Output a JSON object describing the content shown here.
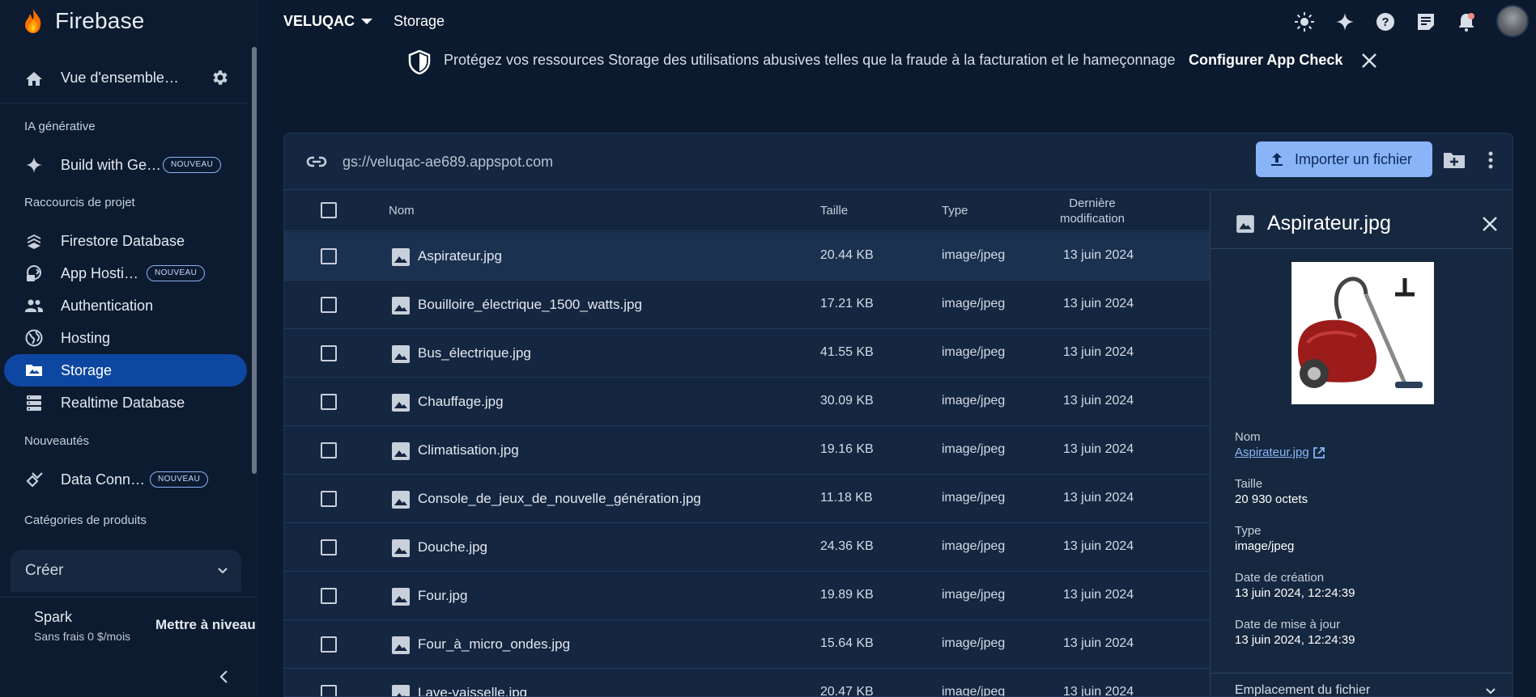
{
  "app": {
    "name": "Firebase"
  },
  "sidebar": {
    "overview_label": "Vue d'ensemble…",
    "sections": {
      "genai": "IA générative",
      "shortcuts": "Raccourcis de projet",
      "new": "Nouveautés",
      "categories": "Catégories de produits"
    },
    "items": [
      {
        "label": "Build with Ge…",
        "badge": "NOUVEAU",
        "icon": "sparkle-icon"
      },
      {
        "label": "Firestore Database",
        "icon": "firestore-icon"
      },
      {
        "label": "App Hosti…",
        "badge": "NOUVEAU",
        "icon": "app-hosting-icon"
      },
      {
        "label": "Authentication",
        "icon": "people-icon"
      },
      {
        "label": "Hosting",
        "icon": "globe-icon"
      },
      {
        "label": "Storage",
        "icon": "folder-image-icon",
        "active": true
      },
      {
        "label": "Realtime Database",
        "icon": "database-icon"
      },
      {
        "label": "Data Conn…",
        "badge": "NOUVEAU",
        "icon": "data-connect-icon"
      }
    ],
    "create_label": "Créer",
    "plan": {
      "name": "Spark",
      "desc": "Sans frais 0 $/mois",
      "upgrade": "Mettre à niveau"
    }
  },
  "topbar": {
    "project": "VELUQAC",
    "page": "Storage"
  },
  "banner": {
    "text": "Protégez vos ressources Storage des utilisations abusives telles que la fraude à la facturation et le hameçonnage",
    "cta": "Configurer App Check"
  },
  "storage": {
    "bucket_url": "gs://veluqac-ae689.appspot.com",
    "upload_label": "Importer un fichier",
    "columns": {
      "name": "Nom",
      "size": "Taille",
      "type": "Type",
      "modified_1": "Dernière",
      "modified_2": "modification"
    },
    "files": [
      {
        "name": "Aspirateur.jpg",
        "size": "20.44 KB",
        "type": "image/jpeg",
        "date": "13 juin 2024"
      },
      {
        "name": "Bouilloire_électrique_1500_watts.jpg",
        "size": "17.21 KB",
        "type": "image/jpeg",
        "date": "13 juin 2024"
      },
      {
        "name": "Bus_électrique.jpg",
        "size": "41.55 KB",
        "type": "image/jpeg",
        "date": "13 juin 2024"
      },
      {
        "name": "Chauffage.jpg",
        "size": "30.09 KB",
        "type": "image/jpeg",
        "date": "13 juin 2024"
      },
      {
        "name": "Climatisation.jpg",
        "size": "19.16 KB",
        "type": "image/jpeg",
        "date": "13 juin 2024"
      },
      {
        "name": "Console_de_jeux_de_nouvelle_génération.jpg",
        "size": "11.18 KB",
        "type": "image/jpeg",
        "date": "13 juin 2024"
      },
      {
        "name": "Douche.jpg",
        "size": "24.36 KB",
        "type": "image/jpeg",
        "date": "13 juin 2024"
      },
      {
        "name": "Four.jpg",
        "size": "19.89 KB",
        "type": "image/jpeg",
        "date": "13 juin 2024"
      },
      {
        "name": "Four_à_micro_ondes.jpg",
        "size": "15.64 KB",
        "type": "image/jpeg",
        "date": "13 juin 2024"
      },
      {
        "name": "Lave-vaisselle.jpg",
        "size": "20.47 KB",
        "type": "image/jpeg",
        "date": "13 juin 2024"
      }
    ]
  },
  "detail": {
    "title": "Aspirateur.jpg",
    "name_label": "Nom",
    "name_value": "Aspirateur.jpg",
    "size_label": "Taille",
    "size_value": "20 930 octets",
    "type_label": "Type",
    "type_value": "image/jpeg",
    "created_label": "Date de création",
    "created_value": "13 juin 2024, 12:24:39",
    "updated_label": "Date de mise à jour",
    "updated_value": "13 juin 2024, 12:24:39",
    "location_label": "Emplacement du fichier"
  },
  "colors": {
    "accent": "#8ab4f8",
    "active_nav": "#0d47a1",
    "background": "#0b1a2e"
  }
}
